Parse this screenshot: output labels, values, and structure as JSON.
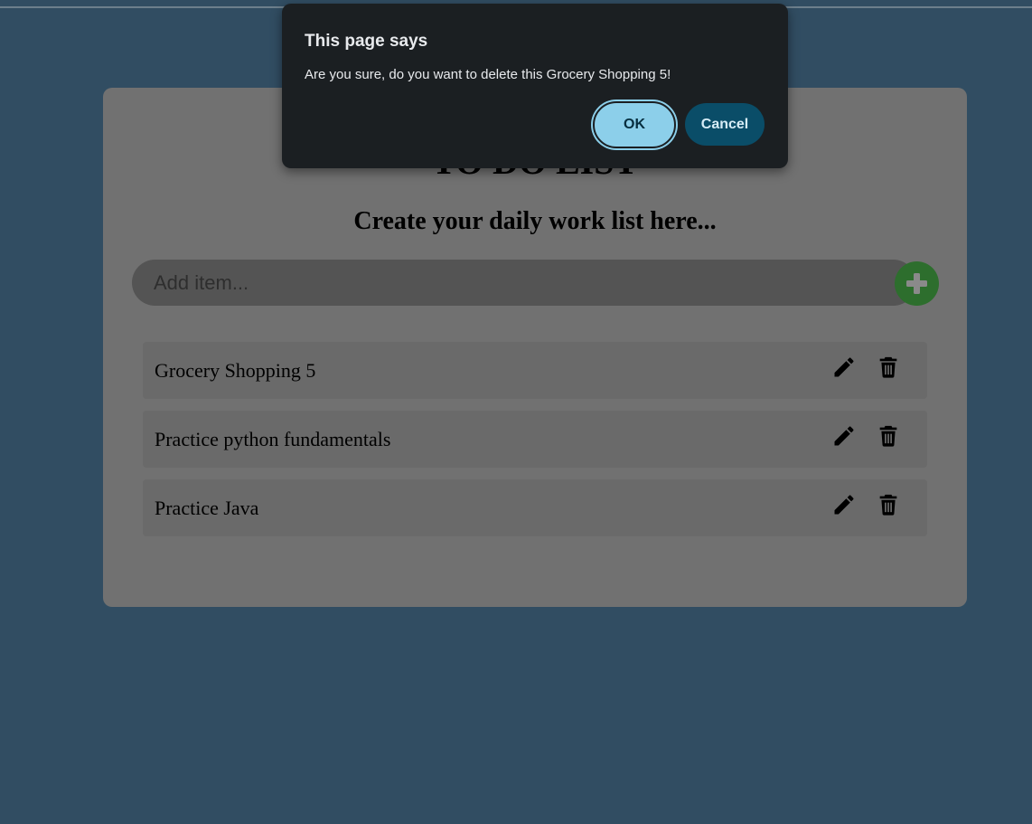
{
  "app": {
    "title": "TO DO LIST",
    "subtitle": "Create your daily work list here..."
  },
  "add_item": {
    "placeholder": "Add item...",
    "button_icon": "plus-icon"
  },
  "todos": [
    {
      "text": "Grocery Shopping 5",
      "edit_icon": "pencil-icon",
      "delete_icon": "trash-icon"
    },
    {
      "text": "Practice python fundamentals",
      "edit_icon": "pencil-icon",
      "delete_icon": "trash-icon"
    },
    {
      "text": "Practice Java",
      "edit_icon": "pencil-icon",
      "delete_icon": "trash-icon"
    }
  ],
  "dialog": {
    "title": "This page says",
    "message": "Are you sure, do you want to delete this Grocery Shopping 5!",
    "ok_label": "OK",
    "cancel_label": "Cancel"
  },
  "colors": {
    "page_background": "#314d62",
    "card_background": "#717171",
    "item_background": "#6a6a6a",
    "add_button": "#2d6e2d",
    "dialog_background": "#1b1f22",
    "ok_button": "#8ccfea",
    "cancel_button": "#0a4d68"
  }
}
